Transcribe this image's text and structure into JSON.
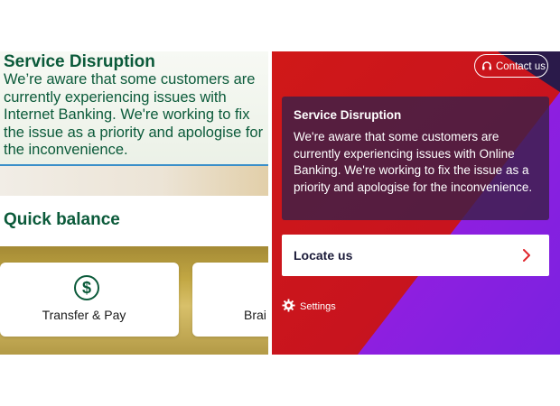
{
  "left_app": {
    "notice": {
      "title": "Service Disruption",
      "body": "We’re aware that some customers are currently experiencing issues with Internet Banking. We're working to fix the issue as a priority and apologise for the inconvenience."
    },
    "quick_balance_title": "Quick balance",
    "tiles": [
      {
        "label": "Transfer & Pay",
        "icon": "dollar-circle-icon"
      },
      {
        "label": "Brai"
      }
    ],
    "colors": {
      "brand_green": "#0b5a3a",
      "gold": "#c2a743",
      "divider_blue": "#3a8fc9"
    }
  },
  "right_app": {
    "contact_label": "Contact us",
    "notice": {
      "title": "Service Disruption",
      "body": "We're aware that some customers are currently experiencing issues with Online Banking. We're working to fix the issue as a priority and apologise for the inconvenience."
    },
    "locate_label": "Locate us",
    "settings_label": "Settings",
    "icons": {
      "contact": "headset-icon",
      "locate": "chevron-right-icon",
      "settings": "gear-icon"
    },
    "colors": {
      "red": "#cc1a1a",
      "purple": "#8a1fd6",
      "navy": "#1c1c3a",
      "chevron_red": "#e0262d"
    }
  }
}
